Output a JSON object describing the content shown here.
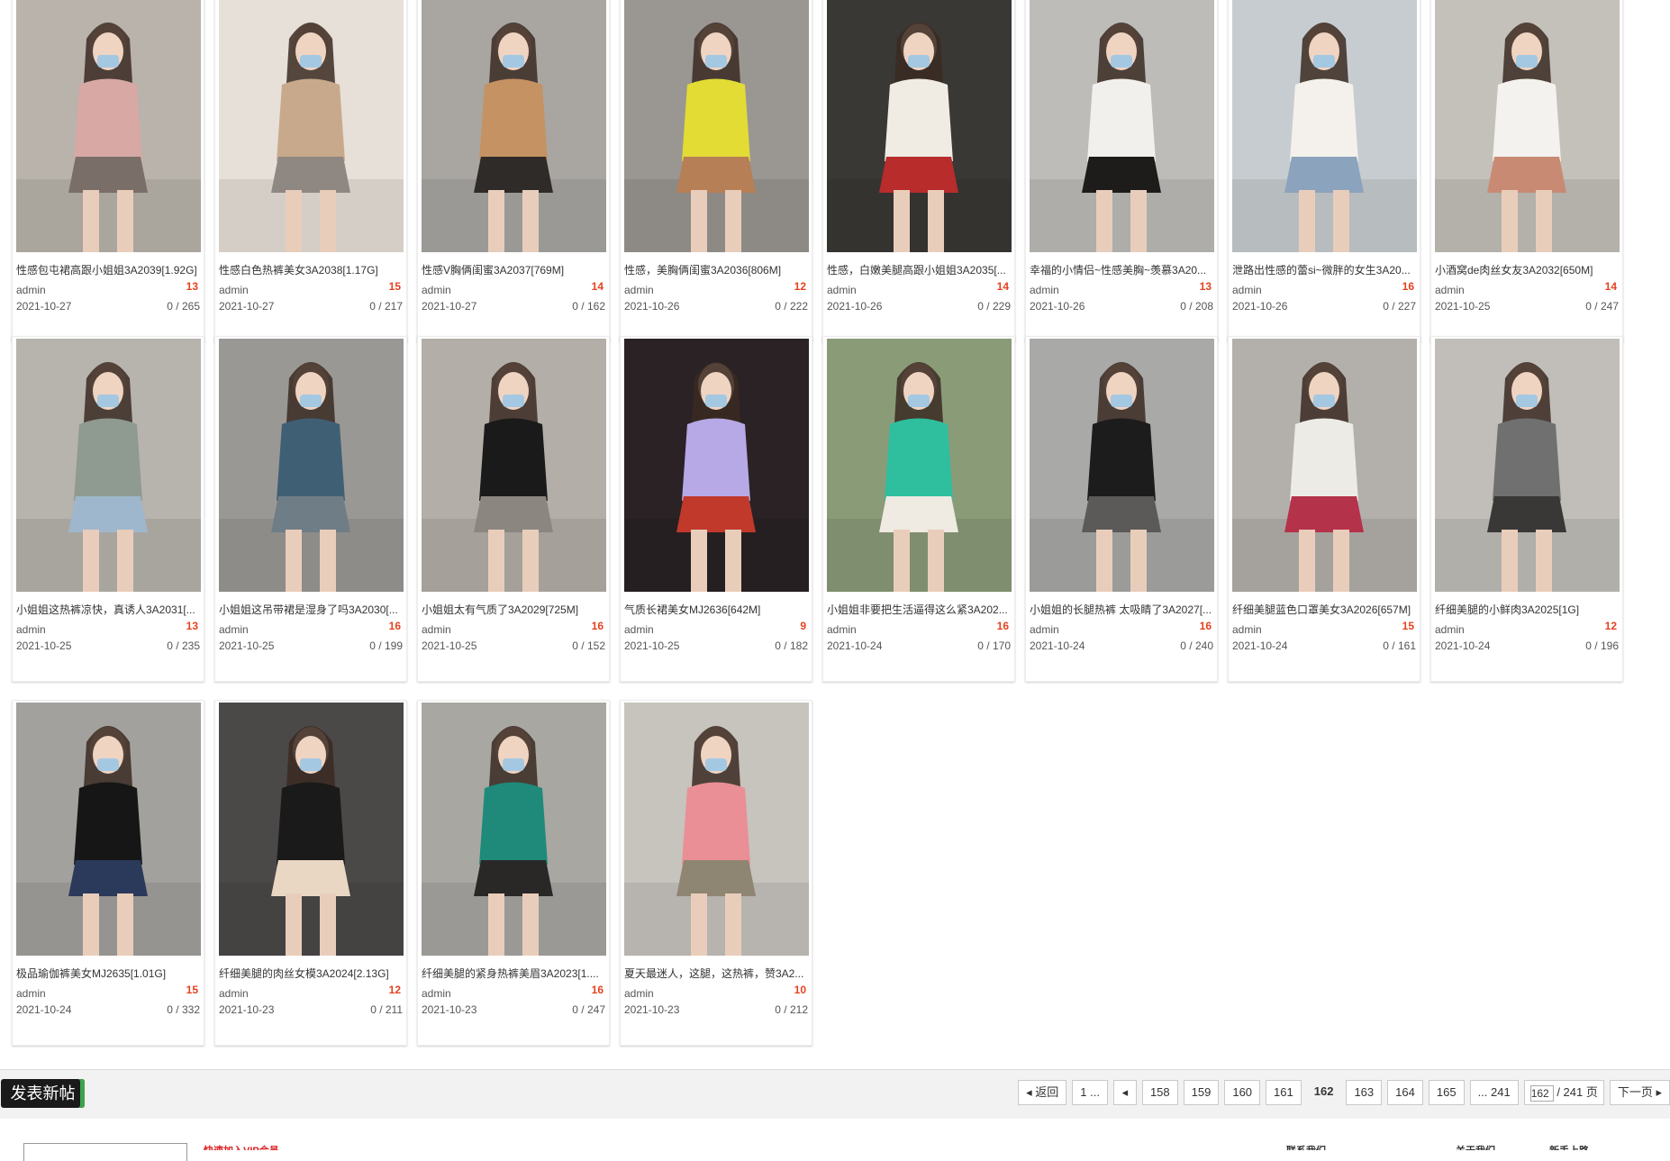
{
  "posts": [
    {
      "title": "性感包屯裙高跟小姐姐3A2039[1.92G]",
      "author": "admin",
      "date": "2021-10-27",
      "pics": "13",
      "stats": "0 / 265",
      "colors": [
        "#b9b3ab",
        "#d7a8a4",
        "#7a6e68"
      ]
    },
    {
      "title": "性感白色热裤美女3A2038[1.17G]",
      "author": "admin",
      "date": "2021-10-27",
      "pics": "15",
      "stats": "0 / 217",
      "colors": [
        "#e6e0d8",
        "#c9a98c",
        "#8e8782"
      ]
    },
    {
      "title": "性感V胸俩闺蜜3A2037[769M]",
      "author": "admin",
      "date": "2021-10-27",
      "pics": "14",
      "stats": "0 / 162",
      "colors": [
        "#a9a6a2",
        "#c59263",
        "#2f2b29"
      ]
    },
    {
      "title": "性感，美胸俩闺蜜3A2036[806M]",
      "author": "admin",
      "date": "2021-10-26",
      "pics": "12",
      "stats": "0 / 222",
      "colors": [
        "#9a9692",
        "#e2dc35",
        "#b77f55"
      ]
    },
    {
      "title": "性感，白嫩美腿高跟小姐姐3A2035[...",
      "author": "admin",
      "date": "2021-10-26",
      "pics": "14",
      "stats": "0 / 229",
      "colors": [
        "#3a3835",
        "#f0ece4",
        "#b82c2c"
      ]
    },
    {
      "title": "幸福的小情侣~性感美胸~羡慕3A20...",
      "author": "admin",
      "date": "2021-10-26",
      "pics": "13",
      "stats": "0 / 208",
      "colors": [
        "#bdbcb8",
        "#f2f0ec",
        "#1e1c1b"
      ]
    },
    {
      "title": "泄路出性感的蕾si~微胖的女生3A20...",
      "author": "admin",
      "date": "2021-10-26",
      "pics": "16",
      "stats": "0 / 227",
      "colors": [
        "#c7ccd0",
        "#f4f1ec",
        "#8ca3bd"
      ]
    },
    {
      "title": "小酒窝de肉丝女友3A2032[650M]",
      "author": "admin",
      "date": "2021-10-25",
      "pics": "14",
      "stats": "0 / 247",
      "colors": [
        "#c4c0ba",
        "#f4f2ee",
        "#c98a74"
      ]
    },
    {
      "title": "小姐姐这热裤凉快，真诱人3A2031[...",
      "author": "admin",
      "date": "2021-10-25",
      "pics": "13",
      "stats": "0 / 235",
      "colors": [
        "#b7b3ad",
        "#8f9a90",
        "#9fb7cc"
      ]
    },
    {
      "title": "小姐姐这吊带裙是湿身了吗3A2030[...",
      "author": "admin",
      "date": "2021-10-25",
      "pics": "16",
      "stats": "0 / 199",
      "colors": [
        "#9a9895",
        "#3f5f74",
        "#6f7e86"
      ]
    },
    {
      "title": "小姐姐太有气质了3A2029[725M]",
      "author": "admin",
      "date": "2021-10-25",
      "pics": "16",
      "stats": "0 / 152",
      "colors": [
        "#b3aea7",
        "#1b1a1a",
        "#8c8680"
      ]
    },
    {
      "title": "气质长裙美女MJ2636[642M]",
      "author": "admin",
      "date": "2021-10-25",
      "pics": "9",
      "stats": "0 / 182",
      "colors": [
        "#2a2224",
        "#b7a9e6",
        "#c0392b"
      ]
    },
    {
      "title": "小姐姐非要把生活逼得这么紧3A202...",
      "author": "admin",
      "date": "2021-10-24",
      "pics": "16",
      "stats": "0 / 170",
      "colors": [
        "#8a9b78",
        "#2fbf9f",
        "#efeae2"
      ]
    },
    {
      "title": "小姐姐的长腿热裤 太吸睛了3A2027[...",
      "author": "admin",
      "date": "2021-10-24",
      "pics": "16",
      "stats": "0 / 240",
      "colors": [
        "#a9a9a7",
        "#1d1c1c",
        "#5b5a58"
      ]
    },
    {
      "title": "纤细美腿蓝色口罩美女3A2026[657M]",
      "author": "admin",
      "date": "2021-10-24",
      "pics": "15",
      "stats": "0 / 161",
      "colors": [
        "#b3b0ab",
        "#ecebe6",
        "#b5324b"
      ]
    },
    {
      "title": "纤细美腿的小鲜肉3A2025[1G]",
      "author": "admin",
      "date": "2021-10-24",
      "pics": "12",
      "stats": "0 / 196",
      "colors": [
        "#c1beb9",
        "#6f706f",
        "#3a3837"
      ]
    },
    {
      "title": "极品瑜伽裤美女MJ2635[1.01G]",
      "author": "admin",
      "date": "2021-10-24",
      "pics": "15",
      "stats": "0 / 332",
      "colors": [
        "#a3a19d",
        "#161616",
        "#2b3a5a"
      ]
    },
    {
      "title": "纤细美腿的肉丝女模3A2024[2.13G]",
      "author": "admin",
      "date": "2021-10-23",
      "pics": "12",
      "stats": "0 / 211",
      "colors": [
        "#4b4848",
        "#1b1a1a",
        "#e9d7c3"
      ]
    },
    {
      "title": "纤细美腿的紧身热裤美眉3A2023[1....",
      "author": "admin",
      "date": "2021-10-23",
      "pics": "16",
      "stats": "0 / 247",
      "colors": [
        "#a9a7a2",
        "#1f8a7a",
        "#2a2727"
      ]
    },
    {
      "title": "夏天最迷人，这腿，这热裤，赞3A2...",
      "author": "admin",
      "date": "2021-10-23",
      "pics": "10",
      "stats": "0 / 212",
      "colors": [
        "#c7c3bd",
        "#e98f95",
        "#8f8573"
      ]
    }
  ],
  "footer": {
    "new_post_label": "发表新帖",
    "pager": {
      "back": "◂ 返回",
      "first": "1 ...",
      "prev": "◂",
      "pages": [
        "158",
        "159",
        "160",
        "161"
      ],
      "current": "162",
      "pages_after": [
        "163",
        "164",
        "165"
      ],
      "last": "... 241",
      "jump_value": "162",
      "jump_total": "/ 241 页",
      "next": "下一页 ▸"
    }
  },
  "below": {
    "notice": "快速加入VIP会员",
    "links": [
      "联系我们",
      "关于我们",
      "新手上路"
    ]
  }
}
